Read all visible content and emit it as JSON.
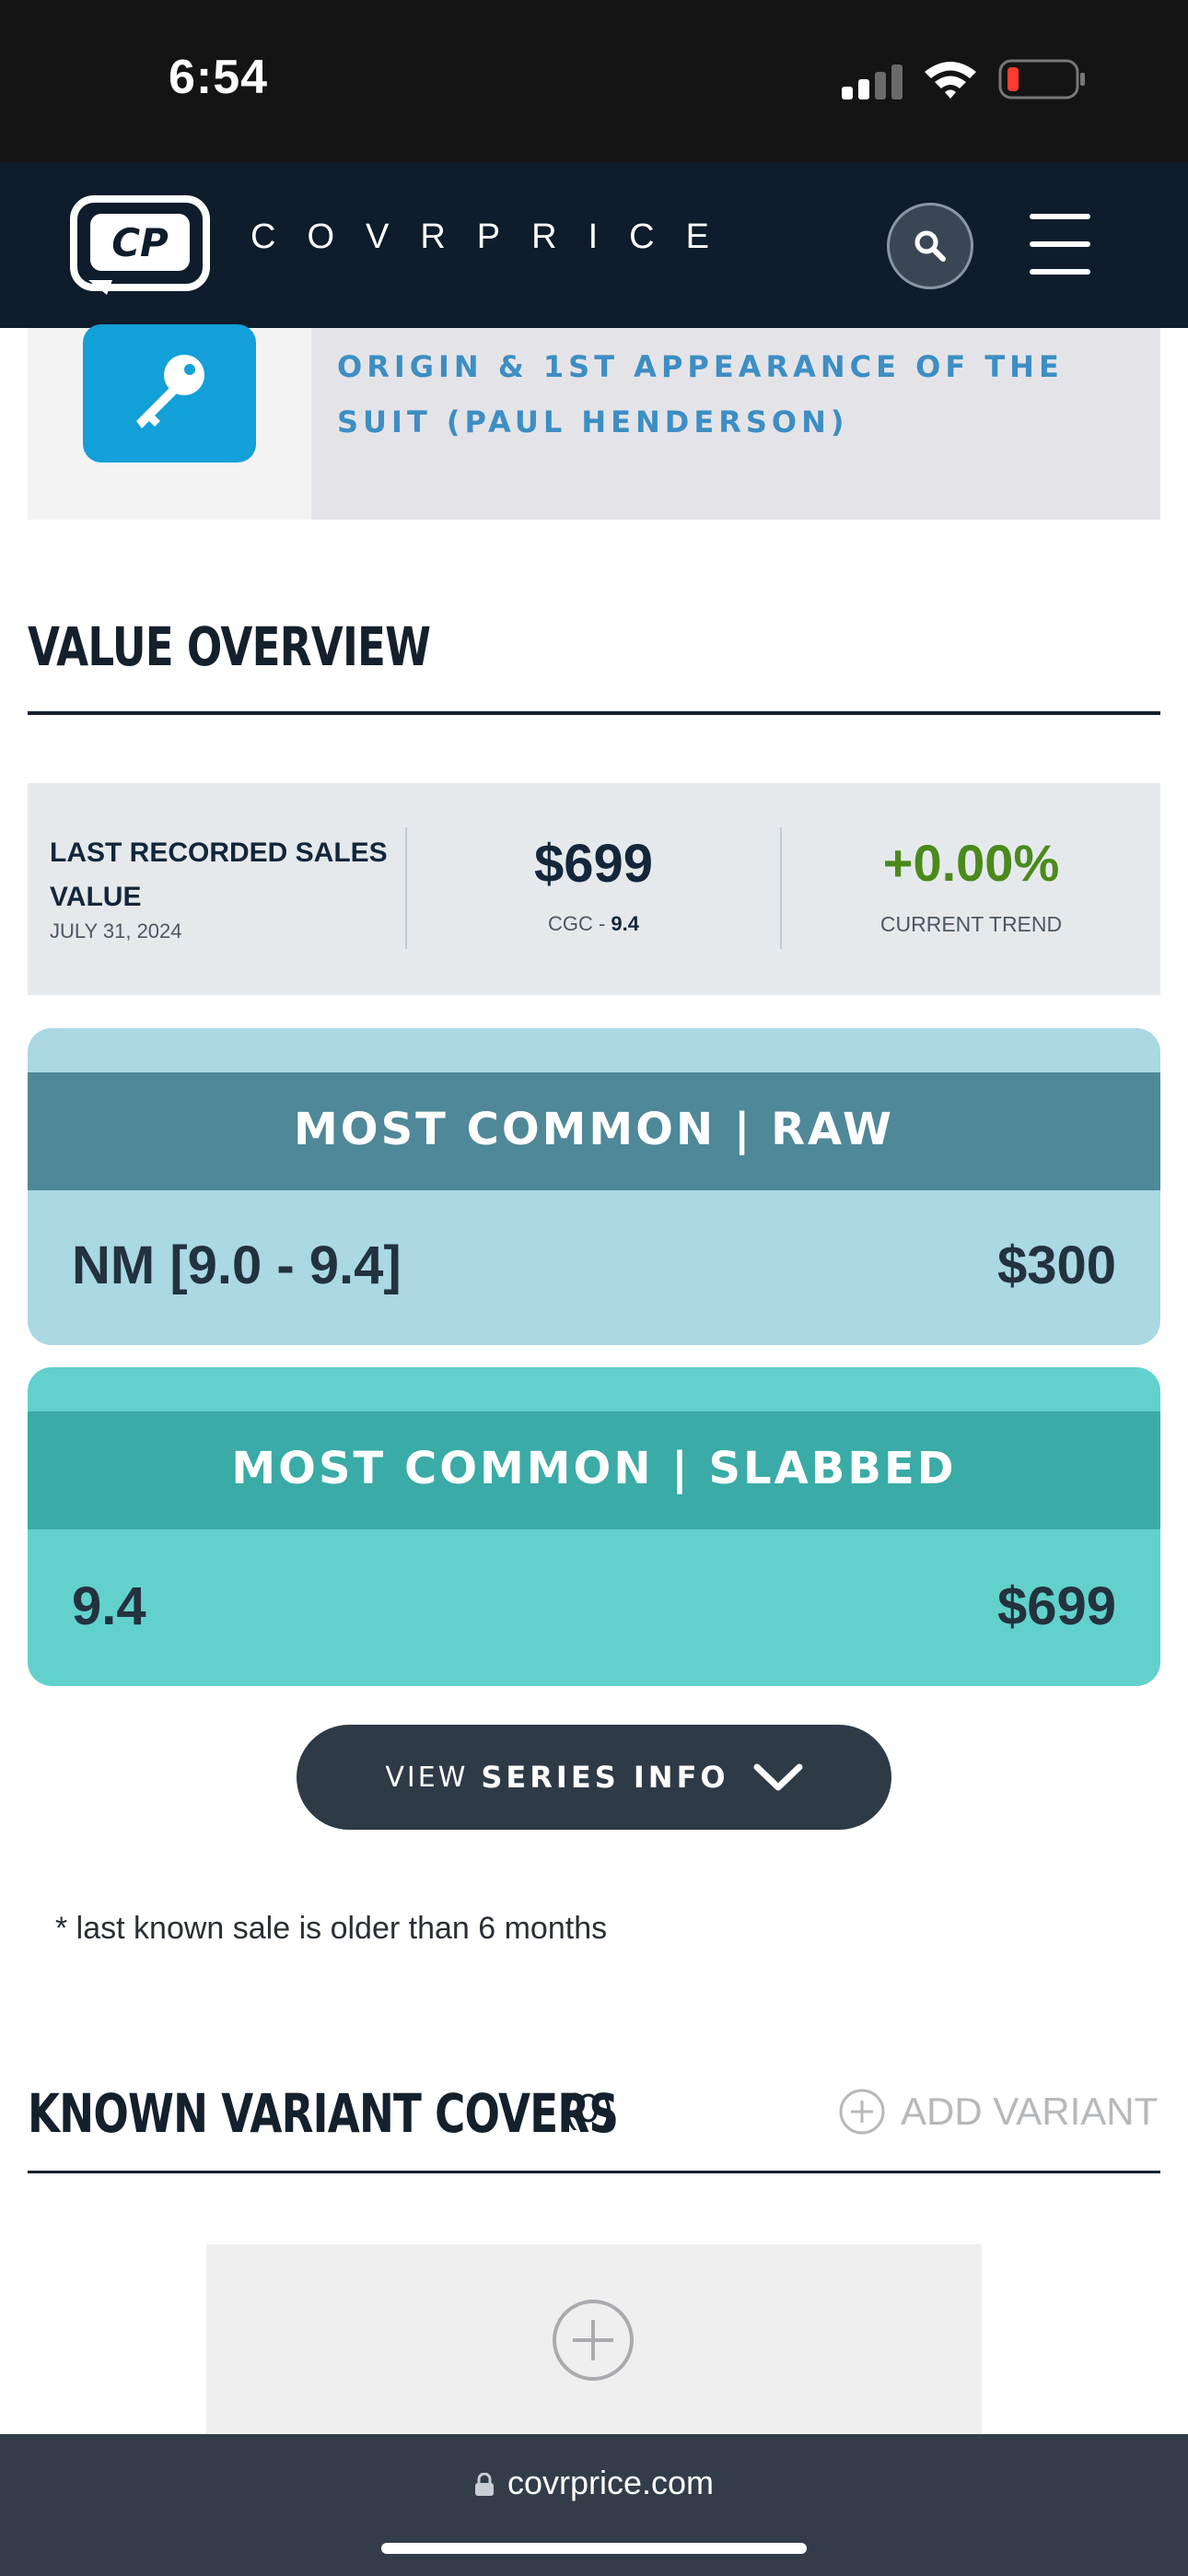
{
  "status_bar": {
    "time": "6:54"
  },
  "header": {
    "logo_mark": "CP",
    "logo_text": "COVRPRICE",
    "search_icon": "search-icon",
    "menu_icon": "hamburger-menu-icon"
  },
  "key_issue": {
    "icon": "key-icon",
    "text": "ORIGIN & 1ST APPEARANCE OF THE SUIT (PAUL HENDERSON)"
  },
  "value_overview": {
    "title": "VALUE OVERVIEW",
    "last_sale_label": "LAST RECORDED SALES VALUE",
    "last_sale_date": "JULY 31, 2024",
    "last_sale_value": "$699",
    "grade_prefix": "CGC - ",
    "grade_value": "9.4",
    "trend_value": "+0.00%",
    "trend_label": "CURRENT TREND",
    "colors": {
      "trend": "#4a8a1c"
    }
  },
  "most_common_raw": {
    "title": "MOST COMMON | RAW",
    "grade": "NM [9.0 - 9.4]",
    "price": "$300"
  },
  "most_common_slabbed": {
    "title": "MOST COMMON | SLABBED",
    "grade": "9.4",
    "price": "$699"
  },
  "series_button": {
    "view": "VIEW",
    "label": "SERIES INFO",
    "icon": "chevron-down-icon"
  },
  "footnote": "* last known sale is older than 6 months",
  "known_variants": {
    "title": "KNOWN VARIANT COVERS",
    "count": "(0)",
    "add_label": "ADD VARIANT"
  },
  "browser": {
    "url": "covrprice.com"
  }
}
